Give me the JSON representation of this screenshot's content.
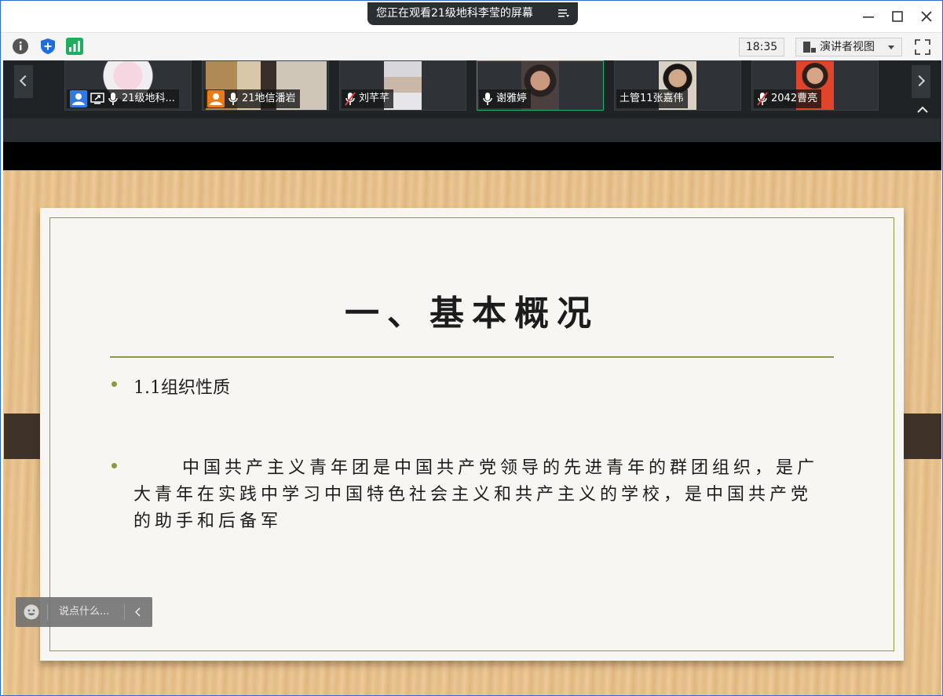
{
  "banner": {
    "text": "您正在观看21级地科李莹的屏幕"
  },
  "toolbar": {
    "time": "18:35",
    "view_label": "演讲者视图"
  },
  "participants": [
    {
      "name": "21级地科...",
      "presenter": true,
      "sharing": true,
      "muted": false
    },
    {
      "name": "21地信潘岩",
      "presenter": false,
      "host": true,
      "muted": false
    },
    {
      "name": "刘芊芊",
      "muted": true
    },
    {
      "name": "谢雅婷",
      "muted": false,
      "speaking": true
    },
    {
      "name": "土管11张嘉伟",
      "muted": false,
      "no_mic_icon": true
    },
    {
      "name": "2042曹亮",
      "muted": true
    }
  ],
  "slide": {
    "title": "一、基本概况",
    "bullet1": "1.1组织性质",
    "bullet2": "中国共产主义青年团是中国共产党领导的先进青年的群团组织，是广大青年在实践中学习中国特色社会主义和共产主义的学校，是中国共产党的助手和后备军"
  },
  "chat": {
    "placeholder": "说点什么..."
  },
  "colors": {
    "accent_green": "#8b9a3f",
    "active_border": "#1db36a",
    "strip_bg": "#1f2326"
  }
}
